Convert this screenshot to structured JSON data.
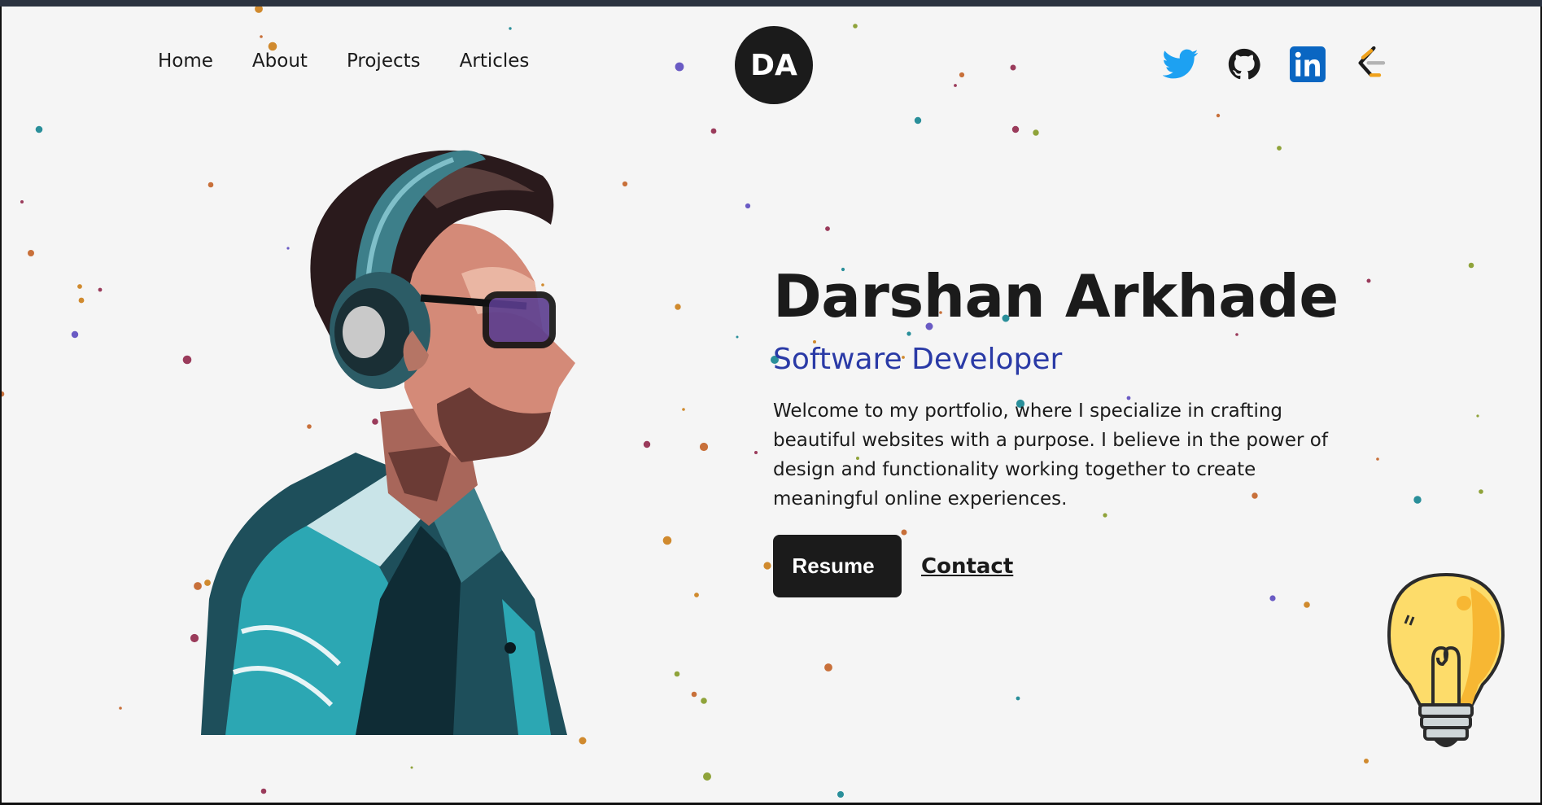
{
  "nav": {
    "items": [
      {
        "label": "Home"
      },
      {
        "label": "About"
      },
      {
        "label": "Projects"
      },
      {
        "label": "Articles"
      }
    ]
  },
  "logo": {
    "initials": "DA"
  },
  "social": [
    {
      "icon": "twitter-icon",
      "color": "#1da1f2"
    },
    {
      "icon": "github-icon",
      "color": "#1b1b1b"
    },
    {
      "icon": "linkedin-icon",
      "color": "#0a66c2"
    },
    {
      "icon": "leetcode-icon",
      "color": "#f0a21c"
    }
  ],
  "hero": {
    "name": "Darshan Arkhade",
    "role": "Software Developer",
    "bio": "Welcome to my portfolio, where I specialize in crafting beautiful websites with a purpose. I believe in the power of design and functionality working together to create meaningful online experiences.",
    "resume_label": "Resume",
    "contact_label": "Contact"
  },
  "colors": {
    "accent": "#2a3aa6",
    "dark": "#1b1b1b",
    "background": "#f5f5f5"
  }
}
